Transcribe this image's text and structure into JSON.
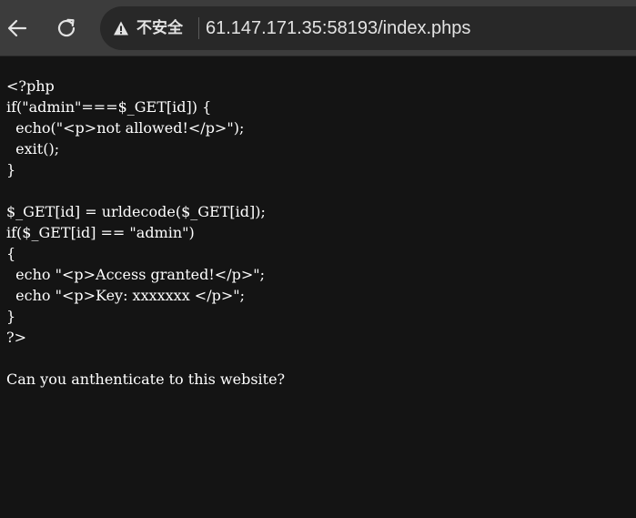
{
  "browser": {
    "security_label": "不安全",
    "url": "61.147.171.35:58193/index.phps",
    "icons": {
      "back": "back-arrow-icon",
      "reload": "reload-icon",
      "security": "warning-triangle-icon"
    }
  },
  "page": {
    "code_lines": [
      "<?php",
      "if(\"admin\"===$_GET[id]) {",
      "  echo(\"<p>not allowed!</p>\");",
      "  exit();",
      "}",
      "",
      "$_GET[id] = urldecode($_GET[id]);",
      "if($_GET[id] == \"admin\")",
      "{",
      "  echo \"<p>Access granted!</p>\";",
      "  echo \"<p>Key: xxxxxxx </p>\";",
      "}",
      "?>",
      "",
      "Can you anthenticate to this website?"
    ]
  },
  "colors": {
    "toolbar": "#3c3c3c",
    "omnibox": "#282828",
    "page_background": "#141414",
    "text": "#ffffff"
  }
}
